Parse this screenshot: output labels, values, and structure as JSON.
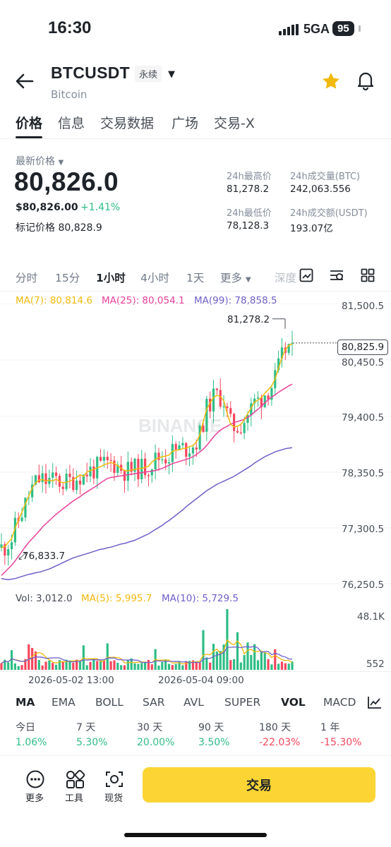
{
  "status": {
    "time": "16:30",
    "network": "5GA",
    "battery": "95"
  },
  "header": {
    "symbol": "BTCUSDT",
    "contract_type": "永续",
    "name": "Bitcoin"
  },
  "tabs": [
    "价格",
    "信息",
    "交易数据",
    "广场",
    "交易-X"
  ],
  "price": {
    "latest_label": "最新价格",
    "last": "80,826.0",
    "usd": "$80,826.00",
    "change": "+1.41%",
    "mark_label": "标记价格",
    "mark_value": "80,828.9"
  },
  "stats": {
    "high_label": "24h最高价",
    "high": "81,278.2",
    "vol_btc_label": "24h成交量(BTC)",
    "vol_btc": "242,063.556",
    "low_label": "24h最低价",
    "low": "78,128.3",
    "vol_usdt_label": "24h成交额(USDT)",
    "vol_usdt": "193.07亿"
  },
  "intervals": [
    "分时",
    "15分",
    "1小时",
    "4小时",
    "1天",
    "更多",
    "深度"
  ],
  "active_interval": "1小时",
  "ma_legend": {
    "ma7": "MA(7): 80,814.6",
    "ma25": "MA(25): 80,054.1",
    "ma99": "MA(99): 78,858.5"
  },
  "price_axis": [
    "81,500.5",
    "80,450.5",
    "79,400.5",
    "78,350.5",
    "77,300.5",
    "76,250.5"
  ],
  "current_price_tag": "80,825.9",
  "high_marker": "81,278.2",
  "low_marker": "76,833.7",
  "watermark": "BINANCE",
  "vol_legend": {
    "vol": "Vol: 3,012.0",
    "ma5": "MA(5): 5,995.7",
    "ma10": "MA(10): 5,729.5"
  },
  "vol_axis": [
    "48.1K",
    "552"
  ],
  "time_axis": [
    "2026-05-02 13:00",
    "2026-05-04 09:00"
  ],
  "indicators": [
    "MA",
    "EMA",
    "BOLL",
    "SAR",
    "AVL",
    "SUPER",
    "VOL",
    "MACD"
  ],
  "periods": {
    "labels": [
      "今日",
      "7 天",
      "30 天",
      "90 天",
      "180 天",
      "1 年"
    ],
    "values": [
      "1.06%",
      "5.30%",
      "20.00%",
      "3.50%",
      "-22.03%",
      "-15.30%"
    ]
  },
  "bottom": {
    "more": "更多",
    "tools": "工具",
    "spot": "现货",
    "trade": "交易"
  },
  "colors": {
    "up": "#2ebd85",
    "down": "#f6465d",
    "ma7": "#f0b90b",
    "ma25": "#e8409a",
    "ma99": "#6e5fc9",
    "accent": "#fcd535"
  },
  "chart_data": {
    "type": "candlestick",
    "interval": "1小时",
    "ylim": [
      76250.5,
      81500.5
    ],
    "x_ticks": [
      "2026-05-02 13:00",
      "2026-05-04 09:00"
    ],
    "high_label": 81278.2,
    "low_label": 76833.7,
    "last": 80825.9,
    "ma7": [
      76980,
      77000,
      77080,
      77150,
      77350,
      77500,
      77650,
      77800,
      77950,
      78100,
      78200,
      78250,
      78260,
      78230,
      78250,
      78230,
      78270,
      78220,
      78200,
      78210,
      78230,
      78260,
      78300,
      78350,
      78320,
      78400,
      78430,
      78450,
      78480,
      78500,
      78540,
      78560,
      78580,
      78560,
      78520,
      78470,
      78430,
      78420,
      78440,
      78450,
      78470,
      78470,
      78490,
      78510,
      78590,
      78640,
      78670,
      78690,
      78700,
      78720,
      78790,
      78810,
      78820,
      78840,
      78850,
      78880,
      78900,
      78960,
      79100,
      79350,
      79580,
      79700,
      79800,
      79840,
      79820,
      79740,
      79500,
      79300,
      79250,
      79260,
      79300,
      79380,
      79500,
      79600,
      79720,
      79750,
      79800,
      79880,
      79950,
      80020,
      80150,
      80350,
      80550,
      80700,
      80780,
      80810
    ],
    "ma25": [
      76460,
      76520,
      76590,
      76650,
      76730,
      76820,
      76910,
      77000,
      77080,
      77150,
      77220,
      77290,
      77370,
      77430,
      77490,
      77550,
      77610,
      77660,
      77710,
      77760,
      77810,
      77860,
      77900,
      77940,
      77990,
      78030,
      78070,
      78110,
      78150,
      78200,
      78240,
      78280,
      78300,
      78310,
      78320,
      78330,
      78340,
      78350,
      78360,
      78370,
      78380,
      78390,
      78400,
      78410,
      78420,
      78430,
      78450,
      78470,
      78500,
      78530,
      78560,
      78580,
      78600,
      78620,
      78640,
      78660,
      78690,
      78730,
      78780,
      78830,
      78900,
      78980,
      79060,
      79130,
      79190,
      79230,
      79260,
      79300,
      79330,
      79350,
      79370,
      79390,
      79430,
      79470,
      79530,
      79580,
      79640,
      79700,
      79760,
      79810,
      79850,
      79900,
      79940,
      79980,
      80020,
      80054
    ],
    "ma99": [
      76400,
      76390,
      76380,
      76390,
      76400,
      76420,
      76440,
      76460,
      76480,
      76490,
      76510,
      76520,
      76540,
      76560,
      76580,
      76610,
      76640,
      76670,
      76700,
      76730,
      76760,
      76790,
      76810,
      76830,
      76850,
      76870,
      76890,
      76910,
      76930,
      76950,
      76960,
      76980,
      76990,
      77010,
      77030,
      77050,
      77060,
      77080,
      77100,
      77120,
      77150,
      77180,
      77210,
      77240,
      77280,
      77320,
      77360,
      77400,
      77450,
      77490,
      77540,
      77590,
      77640,
      77690,
      77750,
      77800,
      77850,
      77900,
      77950,
      78000,
      78050,
      78090,
      78130,
      78170,
      78200,
      78230,
      78260,
      78290,
      78320,
      78360,
      78400,
      78440,
      78480,
      78520,
      78570,
      78610,
      78650,
      78690,
      78720,
      78750,
      78780,
      78800,
      78820,
      78840,
      78850,
      78858
    ]
  }
}
